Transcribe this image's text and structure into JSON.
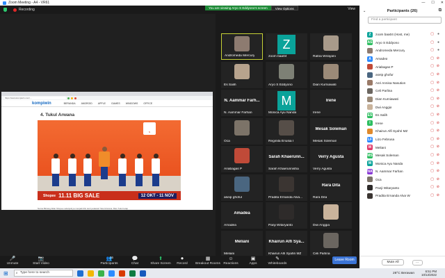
{
  "titlebar": {
    "title": "Zoom Meeting - A4 - VR61",
    "minimize": "—",
    "maximize": "☐",
    "close": "✕"
  },
  "meetbar": {
    "recording": "Recording",
    "viewing_msg": "You are viewing Aryo S Eddyono's screen",
    "view_options": "View Options",
    "view": "View"
  },
  "browser": {
    "url": "https://www.kompiwin.com/...",
    "site_logo": "kompiwin",
    "nav": [
      "BERANDA",
      "ANDROID",
      "APPLE",
      "GAMES",
      "WINDOWS",
      "OFFICE"
    ],
    "heading": "4. Tukul Arwana",
    "banner_brand": "Shopee",
    "banner_sale": "11.11 BIG SALE",
    "banner_date": "12 OKT - 11 NOV",
    "caption": "Nama Bintang Iklan Shopee selanjutnya menjadi dlsi oleh pelawak Tukul Arwana. Mas Tukul tetap"
  },
  "gallery": [
    {
      "name": "Andromeda Mercury",
      "type": "video",
      "color": "#8d7b70",
      "active": true
    },
    {
      "name": "zoom baa04",
      "type": "letter",
      "letter": "Z",
      "color": "#0aa39a"
    },
    {
      "name": "Ratna Wirayani",
      "type": "video",
      "color": "#a89a8a"
    },
    {
      "name": "Es Salih",
      "type": "video",
      "color": "#b7a38d"
    },
    {
      "name": "Aryo S Eddyono",
      "type": "video",
      "color": "#7d8075"
    },
    {
      "name": "Dian Kurniawati",
      "type": "video",
      "color": "#9b8a78"
    },
    {
      "name": "N. Aammar Farhan",
      "type": "text",
      "big": "N. Aammar Farh..."
    },
    {
      "name": "Monica Ayu Nanda",
      "type": "letter",
      "letter": "M",
      "color": "#0aa39a"
    },
    {
      "name": "Irene",
      "type": "text",
      "big": "Irene"
    },
    {
      "name": "Oca",
      "type": "video",
      "color": "#7c7368"
    },
    {
      "name": "Reginita Eriusia I",
      "type": "video",
      "color": "#564e48"
    },
    {
      "name": "Mesak Soleman",
      "type": "text",
      "big": "Mesak Soleman"
    },
    {
      "name": "Ariabagas P",
      "type": "video",
      "color": "#c04a38"
    },
    {
      "name": "Sarah Khaerunnisha",
      "type": "text",
      "big": "Sarah Khaerunn..."
    },
    {
      "name": "Verry Agusta",
      "type": "text",
      "big": "Verry Agusta"
    },
    {
      "name": "aseip ghofur",
      "type": "video",
      "color": "#4a6680"
    },
    {
      "name": "Pradita Ernanda Alva...",
      "type": "video",
      "color": "#3b3532"
    },
    {
      "name": "Rara Dita",
      "type": "text",
      "big": "Rara Dita"
    },
    {
      "name": "Amadea",
      "type": "text",
      "big": "Amadea"
    },
    {
      "name": "Panji Witaryanto",
      "type": "video",
      "color": "#2e2b2a"
    },
    {
      "name": "Dwi Anggia",
      "type": "video",
      "color": "#c9b39b"
    },
    {
      "name": "Meliani",
      "type": "text",
      "big": "Meliani"
    },
    {
      "name": "Khairun Alfi Syahri MZ",
      "type": "text",
      "big": "Khairun Alfi Sya..."
    },
    {
      "name": "Celi Parlina",
      "type": "video",
      "color": "#6b6660"
    }
  ],
  "toolbar": [
    {
      "glyph": "🎤",
      "label": "Unmute"
    },
    {
      "glyph": "📷",
      "label": "Start Video"
    },
    {
      "glyph": "👥",
      "label": "Participants",
      "badge": "26"
    },
    {
      "glyph": "💬",
      "label": "Chat"
    },
    {
      "glyph": "⬆",
      "label": "Share Screen"
    },
    {
      "glyph": "⏺",
      "label": "Record"
    },
    {
      "glyph": "▦",
      "label": "Breakout Rooms"
    },
    {
      "glyph": "☺",
      "label": "Reactions"
    },
    {
      "glyph": "▣",
      "label": "Apps"
    },
    {
      "glyph": "✎",
      "label": "Whiteboards"
    }
  ],
  "leave": "Leave Room",
  "panel": {
    "title": "Participants (26)",
    "search_placeholder": "Find a participant",
    "mute_all": "Mute All",
    "more": "···"
  },
  "participants": [
    {
      "initial": "Z",
      "name": "zoom baa04 (Host, me)",
      "color": "#0aa39a",
      "muted": false
    },
    {
      "initial": "AS",
      "name": "Aryo S Eddyono",
      "color": "#2dbe60",
      "muted": false
    },
    {
      "initial": "",
      "name": "Andromeda Mercury",
      "color": "#8d7b70",
      "muted": false
    },
    {
      "initial": "A",
      "name": "Amadea",
      "color": "#2d8cff",
      "muted": true
    },
    {
      "initial": "",
      "name": "Ariabagas P",
      "color": "#c04a38",
      "muted": true
    },
    {
      "initial": "",
      "name": "aseip ghofur",
      "color": "#4a6680",
      "muted": true
    },
    {
      "initial": "",
      "name": "Asri Annisa Nasution",
      "color": "#9a7a68",
      "muted": true
    },
    {
      "initial": "",
      "name": "Celi Parlina",
      "color": "#6b6660",
      "muted": true
    },
    {
      "initial": "",
      "name": "Dian Kurniawati",
      "color": "#9b8a78",
      "muted": true
    },
    {
      "initial": "",
      "name": "Dwi Anggia",
      "color": "#c9b39b",
      "muted": true
    },
    {
      "initial": "ES",
      "name": "Es Salih",
      "color": "#2dbe60",
      "muted": true
    },
    {
      "initial": "I",
      "name": "Irene",
      "color": "#2dbe60",
      "muted": true
    },
    {
      "initial": "",
      "name": "Khairun Alfi Syahri MZ",
      "color": "#e08a2c",
      "muted": true
    },
    {
      "initial": "LF",
      "name": "Lizo Februsa",
      "color": "#2d8cff",
      "muted": true
    },
    {
      "initial": "M",
      "name": "Meliani",
      "color": "#e03b6a",
      "muted": true
    },
    {
      "initial": "MS",
      "name": "Mesak Soleman",
      "color": "#2dbe60",
      "muted": true
    },
    {
      "initial": "M",
      "name": "Monica Ayu Nanda",
      "color": "#0aa39a",
      "muted": true
    },
    {
      "initial": "NA",
      "name": "N. Aammar Farhan",
      "color": "#8a3bd6",
      "muted": true
    },
    {
      "initial": "",
      "name": "Oca",
      "color": "#7c7368",
      "muted": true
    },
    {
      "initial": "",
      "name": "Panji Witaryanto",
      "color": "#2e2b2a",
      "muted": true
    },
    {
      "initial": "",
      "name": "Pradita Ernanda Alva W",
      "color": "#3b3532",
      "muted": true
    }
  ],
  "taskbar": {
    "search": "Type here to search",
    "weather": "28°C Berawan",
    "time": "6:51 PM",
    "date": "10/13/2022"
  }
}
